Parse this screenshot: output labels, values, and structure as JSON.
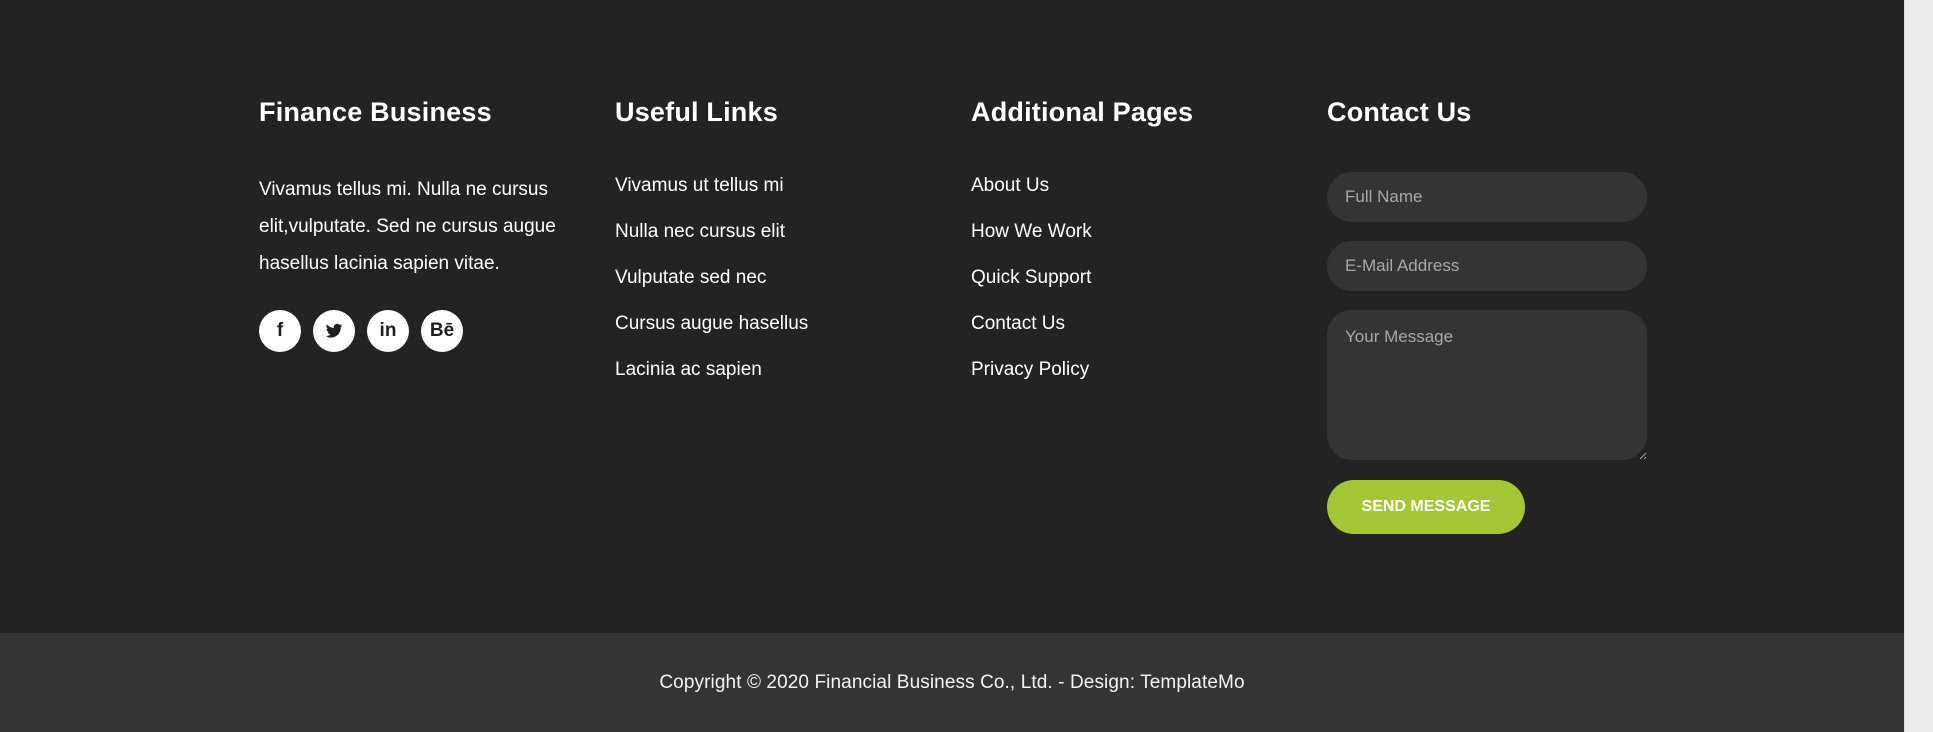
{
  "footer": {
    "finance_business": {
      "title": "Finance Business",
      "description": "Vivamus tellus mi. Nulla ne cursus elit,vulputate. Sed ne cursus augue hasellus lacinia sapien vitae.",
      "social_icons": [
        {
          "name": "facebook-icon",
          "label": "f"
        },
        {
          "name": "twitter-icon",
          "label": ""
        },
        {
          "name": "linkedin-icon",
          "label": "in"
        },
        {
          "name": "behance-icon",
          "label": "Bē"
        }
      ]
    },
    "useful_links": {
      "title": "Useful Links",
      "items": [
        "Vivamus ut tellus mi",
        "Nulla nec cursus elit",
        "Vulputate sed nec",
        "Cursus augue hasellus",
        "Lacinia ac sapien"
      ]
    },
    "additional_pages": {
      "title": "Additional Pages",
      "items": [
        "About Us",
        "How We Work",
        "Quick Support",
        "Contact Us",
        "Privacy Policy"
      ]
    },
    "contact": {
      "title": "Contact Us",
      "full_name_placeholder": "Full Name",
      "email_placeholder": "E-Mail Address",
      "message_placeholder": "Your Message",
      "send_label": "SEND MESSAGE"
    },
    "copyright": "Copyright © 2020 Financial Business Co., Ltd. - Design: TemplateMo"
  },
  "colors": {
    "footer_background": "#232323",
    "bottom_background": "#343434",
    "input_background": "#343434",
    "accent": "#a4c639",
    "text": "#ffffff",
    "placeholder": "#a8a8a8"
  }
}
